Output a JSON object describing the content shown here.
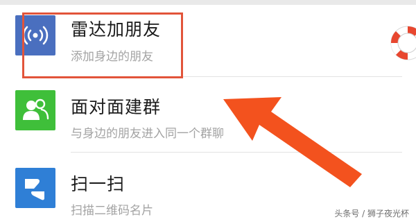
{
  "menu": {
    "items": [
      {
        "title": "雷达加朋友",
        "subtitle": "添加身边的朋友",
        "icon": "radar-icon",
        "color": "#4a6fbf"
      },
      {
        "title": "面对面建群",
        "subtitle": "与身边的朋友进入同一个群聊",
        "icon": "group-people-icon",
        "color": "#3fbf3a"
      },
      {
        "title": "扫一扫",
        "subtitle": "扫描二维码名片",
        "icon": "scan-icon",
        "color": "#2f7fd6"
      }
    ]
  },
  "annotation": {
    "highlight_color": "#e2543a",
    "arrow_color": "#f3521e"
  },
  "watermark": {
    "text": "头条号 / 狮子夜光杯"
  }
}
